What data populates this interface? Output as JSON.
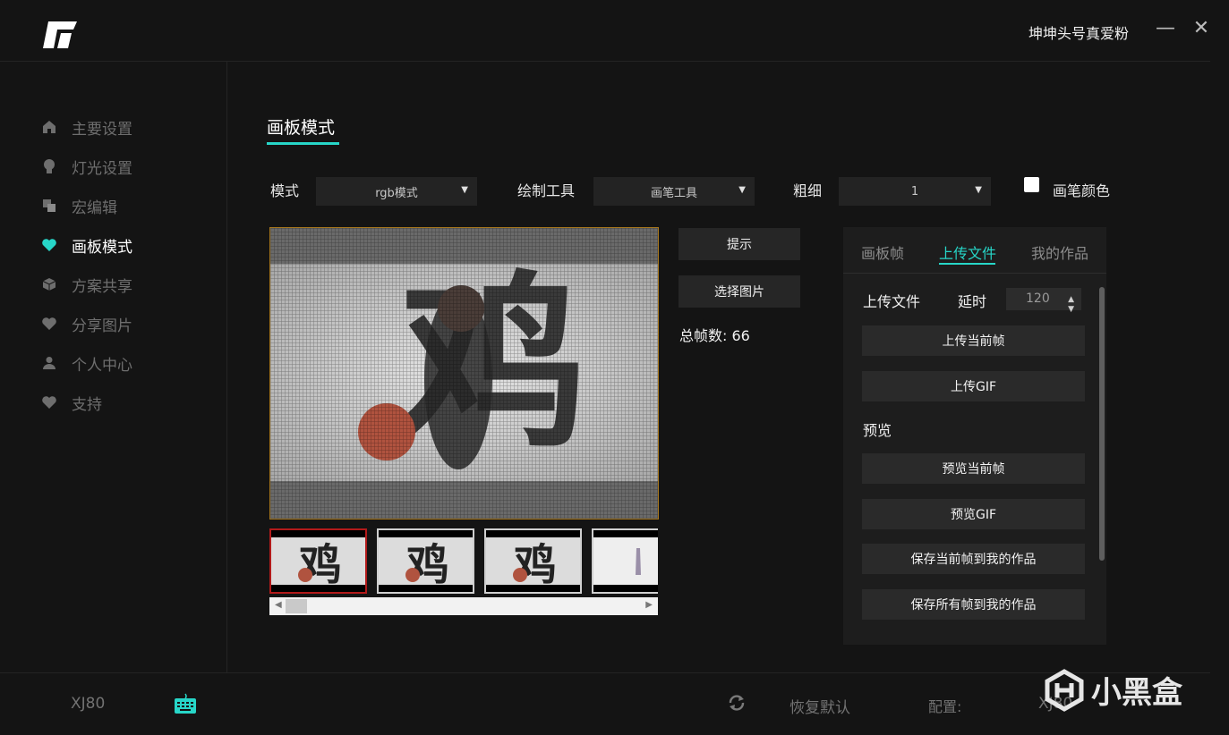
{
  "window": {
    "user_name": "坤坤头号真爱粉",
    "minimize": "—",
    "close": "✕"
  },
  "sidebar": {
    "items": [
      {
        "label": "主要设置",
        "icon": "home-icon",
        "active": false
      },
      {
        "label": "灯光设置",
        "icon": "bulb-icon",
        "active": false
      },
      {
        "label": "宏编辑",
        "icon": "layers-icon",
        "active": false
      },
      {
        "label": "画板模式",
        "icon": "heart-icon",
        "active": true
      },
      {
        "label": "方案共享",
        "icon": "cube-icon",
        "active": false
      },
      {
        "label": "分享图片",
        "icon": "heart-icon",
        "active": false
      },
      {
        "label": "个人中心",
        "icon": "user-icon",
        "active": false
      },
      {
        "label": "支持",
        "icon": "heart-icon",
        "active": false
      }
    ]
  },
  "page": {
    "title": "画板模式"
  },
  "controls": {
    "mode_label": "模式",
    "mode_value": "rgb模式",
    "tool_label": "绘制工具",
    "tool_value": "画笔工具",
    "thickness_label": "粗细",
    "thickness_value": "1",
    "color_label": "画笔颜色",
    "color_value": "#ffffff"
  },
  "canvas": {
    "image_text": "鸡",
    "hint_button": "提示",
    "choose_image_button": "选择图片",
    "total_frames": "总帧数: 66",
    "selected_thumbnail": 1
  },
  "panel": {
    "tabs": [
      "画板帧",
      "上传文件",
      "我的作品"
    ],
    "active_tab": 1,
    "upload_label": "上传文件",
    "delay_label": "延时",
    "delay_value": "120",
    "upload_current_frame": "上传当前帧",
    "upload_gif": "上传GIF",
    "preview_label": "预览",
    "preview_current_frame": "预览当前帧",
    "preview_gif": "预览GIF",
    "save_current_frame": "保存当前帧到我的作品",
    "save_all_frames": "保存所有帧到我的作品"
  },
  "footer": {
    "device": "XJ80",
    "restore": "恢复默认",
    "config_label": "配置:",
    "config_value": "XJ80",
    "watermark_text": "小黑盒"
  },
  "colors": {
    "accent": "#27d6c8",
    "canvas_border": "#a7771d",
    "thumb_selected": "#b21a1a"
  }
}
